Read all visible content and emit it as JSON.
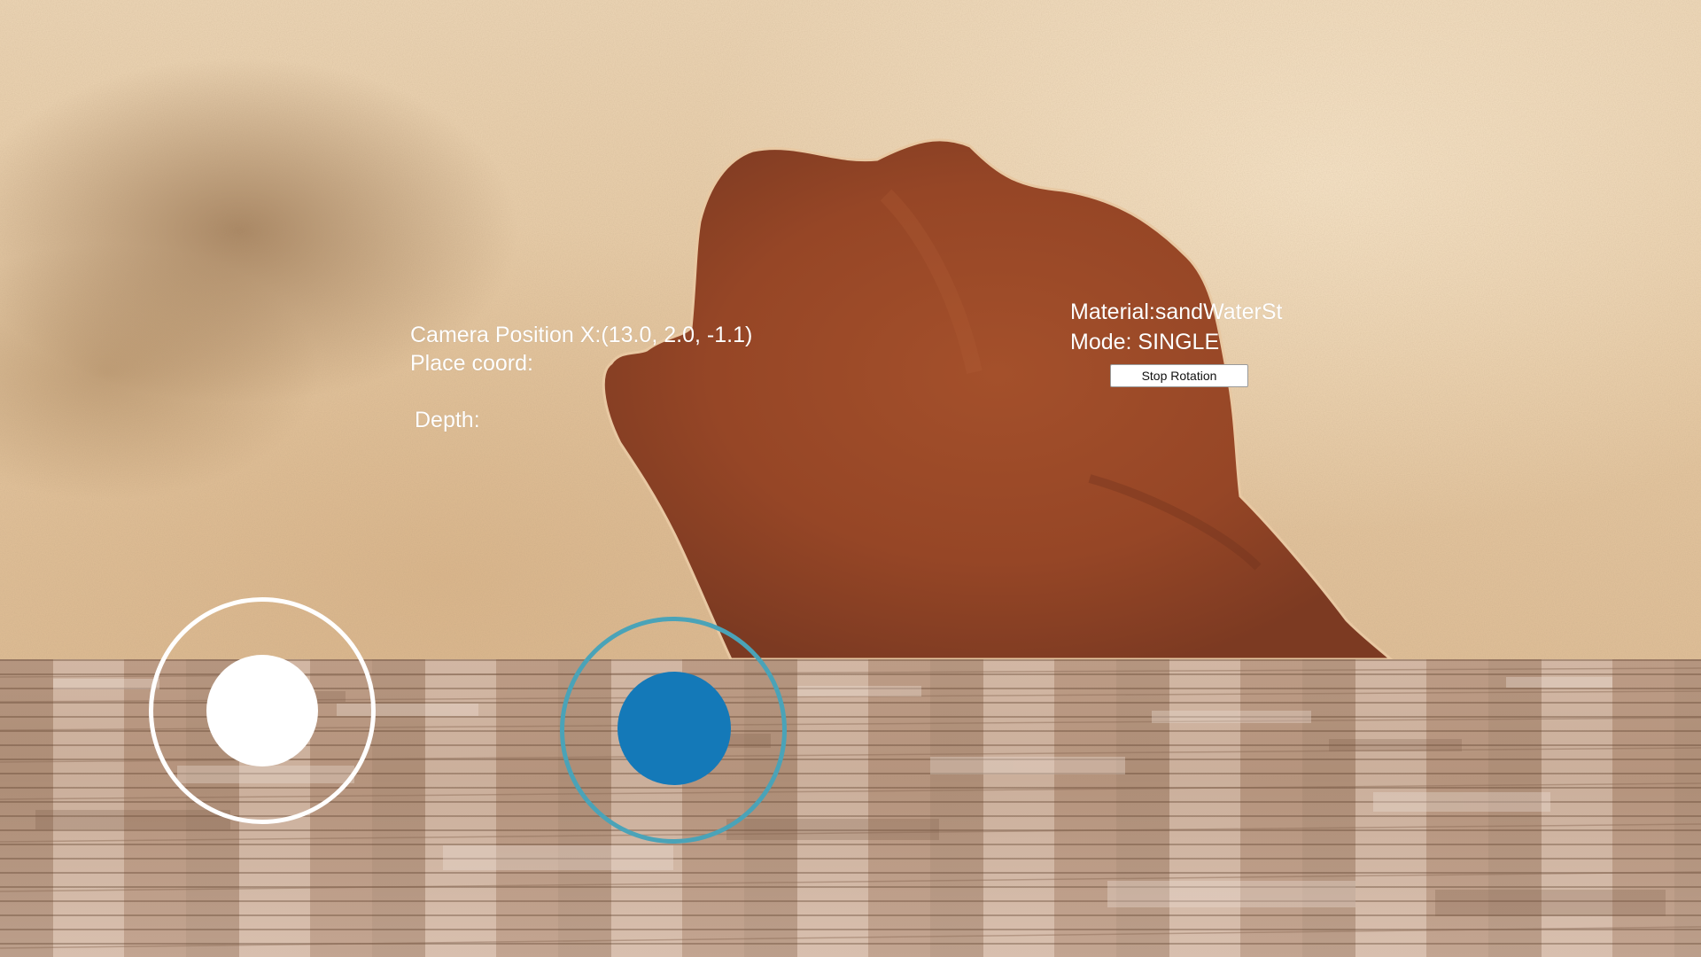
{
  "hud": {
    "camera_position": "Camera Position X:(13.0, 2.0, -1.1)",
    "place_coord": "Place coord:",
    "depth": "Depth:",
    "material": "Material:sandWaterSt",
    "mode": "Mode: SINGLE"
  },
  "controls": {
    "stop_rotation_label": "Stop Rotation"
  },
  "joysticks": {
    "left_icon": "joystick-white",
    "right_icon": "joystick-blue",
    "right_knob_color": "#1479b8",
    "right_ring_color": "#4aa3b8",
    "left_color": "#ffffff"
  }
}
